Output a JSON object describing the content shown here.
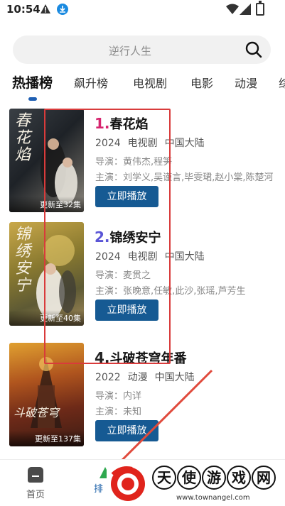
{
  "status_bar": {
    "time": "10:54",
    "icons": [
      "warning-icon",
      "download-icon",
      "wifi-icon",
      "signal-icon",
      "battery-icon"
    ]
  },
  "search": {
    "placeholder": "逆行人生"
  },
  "tabs": [
    {
      "label": "热播榜",
      "active": true
    },
    {
      "label": "飙升榜",
      "active": false
    },
    {
      "label": "电视剧",
      "active": false
    },
    {
      "label": "电影",
      "active": false
    },
    {
      "label": "动漫",
      "active": false
    },
    {
      "label": "综",
      "active": false
    }
  ],
  "items": [
    {
      "rank": "1.",
      "rank_color": "#d6246e",
      "title": "春花焰",
      "year": "2024",
      "type": "电视剧",
      "region": "中国大陆",
      "director": "导演：黄伟杰,程笋",
      "cast": "主演：刘学义,吴谨言,毕雯珺,赵小棠,陈楚河",
      "update": "更新至32集",
      "poster_text": "春花焰",
      "button": "立即播放"
    },
    {
      "rank": "2.",
      "rank_color": "#5a55d6",
      "title": "锦绣安宁",
      "year": "2024",
      "type": "电视剧",
      "region": "中国大陆",
      "director": "导演：麦贯之",
      "cast": "主演：张晚意,任敏,此沙,张瑶,芦芳生",
      "update": "更新至40集",
      "poster_text": "锦绣安宁",
      "button": "立即播放"
    },
    {
      "rank": "4.",
      "rank_color": "#222222",
      "title": "斗破苍穹年番",
      "year": "2022",
      "type": "动漫",
      "region": "中国大陆",
      "director": "导演：内详",
      "cast": "主演：未知",
      "update": "更新至137集",
      "poster_text": "斗破苍穹",
      "button": "立即播放"
    }
  ],
  "bottom_nav": {
    "home_label": "首页",
    "rank_label": "排"
  },
  "watermark": {
    "chars": [
      "天",
      "使",
      "游",
      "戏",
      "网"
    ],
    "url": "www.townangel.com"
  },
  "colors": {
    "accent": "#165a93",
    "annotation": "#d93b3b"
  }
}
